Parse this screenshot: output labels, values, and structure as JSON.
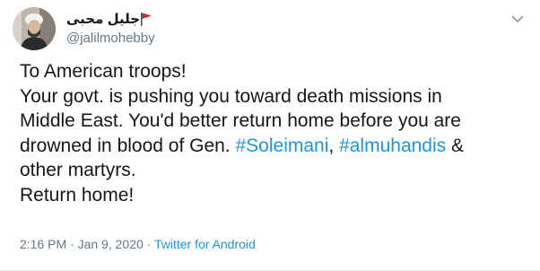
{
  "tweet": {
    "display_name": "جلیل محبی",
    "handle": "@jalilmohebby",
    "flag_icon": "iran-flag-icon",
    "lines": {
      "l1": "To American troops!",
      "l2": "Your govt. is pushing you toward death missions in",
      "l3": "Middle East. You'd better return home before you are",
      "l4_pre": "drowned in blood of Gen. ",
      "l4_tag1": "#Soleimani",
      "l4_sep": ", ",
      "l4_tag2": "#almuhandis",
      "l4_post": " &",
      "l5": "other martyrs.",
      "l6": "Return home!"
    },
    "time": "2:16 PM",
    "dot": "·",
    "date": "Jan 9, 2020",
    "source": "Twitter for Android"
  },
  "colors": {
    "link": "#1b95e0",
    "meta": "#657786",
    "text": "#14171a"
  }
}
